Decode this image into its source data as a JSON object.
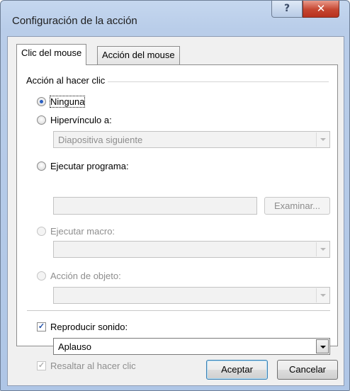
{
  "window": {
    "title": "Configuración de la acción",
    "help_label": "?",
    "close_label": "✕"
  },
  "tabs": [
    {
      "label": "Clic del mouse",
      "active": true
    },
    {
      "label": "Acción del mouse",
      "active": false
    }
  ],
  "group": {
    "label": "Acción al hacer clic"
  },
  "options": {
    "none_label": "Ninguna",
    "hyperlink_label": "Hipervínculo a:",
    "hyperlink_value": "Diapositiva siguiente",
    "run_program_label": "Ejecutar programa:",
    "run_program_value": "",
    "browse_label": "Examinar...",
    "run_macro_label": "Ejecutar macro:",
    "run_macro_value": "",
    "object_action_label": "Acción de objeto:",
    "object_action_value": "",
    "selected": "Ninguna"
  },
  "sound": {
    "play_label": "Reproducir sonido:",
    "play_checked": true,
    "sound_value": "Aplauso",
    "highlight_label": "Resaltar al hacer clic",
    "highlight_checked": true
  },
  "buttons": {
    "ok_label": "Aceptar",
    "cancel_label": "Cancelar"
  },
  "colors": {
    "titlebar": "#c5d7ef",
    "close_button": "#c54530",
    "radio_selected": "#2a5fc1",
    "default_button_border": "#3c7fb1"
  }
}
